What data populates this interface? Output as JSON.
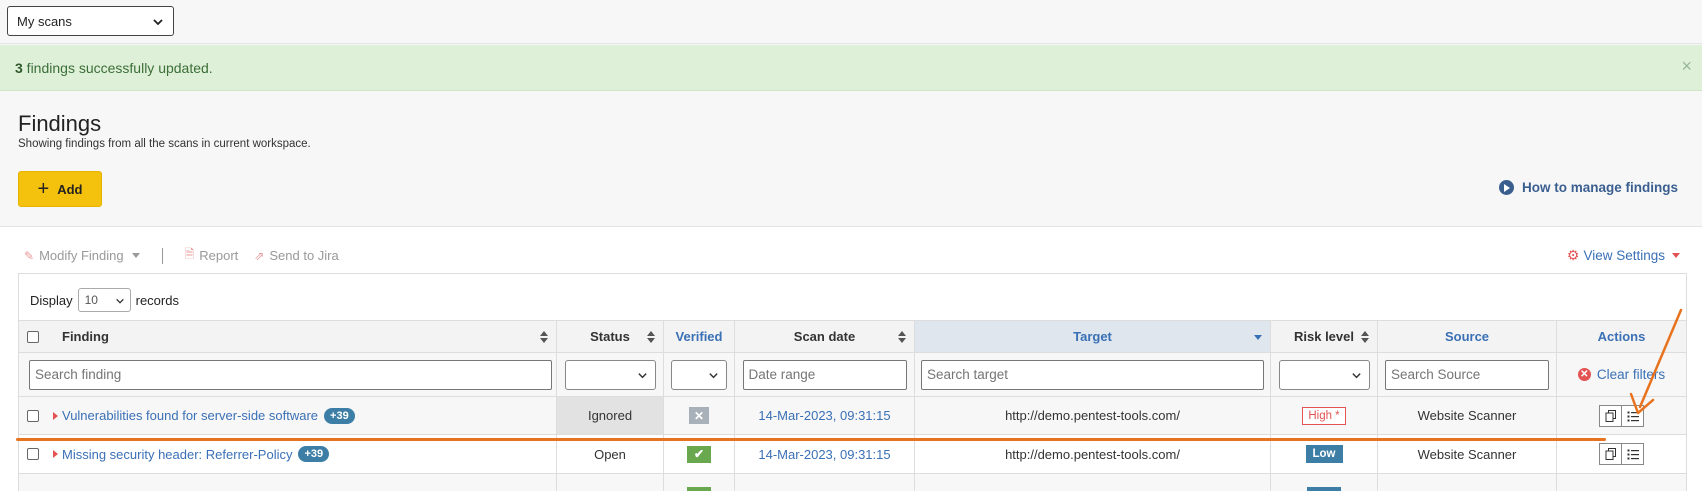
{
  "topbar": {
    "scan_filter": "My scans"
  },
  "alert": {
    "count": "3",
    "message": " findings successfully updated.",
    "close": "×"
  },
  "header": {
    "title": "Findings",
    "subtitle": "Showing findings from all the scans in current workspace.",
    "add_label": "Add",
    "help_link": "How to manage findings"
  },
  "toolbar": {
    "modify": "Modify Finding",
    "report": "Report",
    "send_jira": "Send to Jira",
    "view_settings": "View Settings"
  },
  "display": {
    "prefix": "Display",
    "value": "10",
    "suffix": "records"
  },
  "columns": {
    "finding": "Finding",
    "status": "Status",
    "verified": "Verified",
    "scan_date": "Scan date",
    "target": "Target",
    "risk": "Risk level",
    "source": "Source",
    "actions": "Actions"
  },
  "filters": {
    "finding_placeholder": "Search finding",
    "date_placeholder": "Date range",
    "target_placeholder": "Search target",
    "source_placeholder": "Search Source",
    "clear": "Clear filters"
  },
  "rows": [
    {
      "finding": "Vulnerabilities found for server-side software",
      "badge": "+39",
      "status": "Ignored",
      "verified": "✕",
      "date": "14-Mar-2023, 09:31:15",
      "target": "http://demo.pentest-tools.com/",
      "risk": "High *",
      "source": "Website Scanner"
    },
    {
      "finding": "Missing security header: Referrer-Policy",
      "badge": "+39",
      "status": "Open",
      "verified": "✔",
      "date": "14-Mar-2023, 09:31:15",
      "target": "http://demo.pentest-tools.com/",
      "risk": "Low",
      "source": "Website Scanner"
    }
  ],
  "colors": {
    "accent": "#3a70b5",
    "alert_bg": "#dff0d8",
    "add_button": "#f4c20d",
    "danger": "#e35353",
    "annotation": "#e8731f"
  }
}
